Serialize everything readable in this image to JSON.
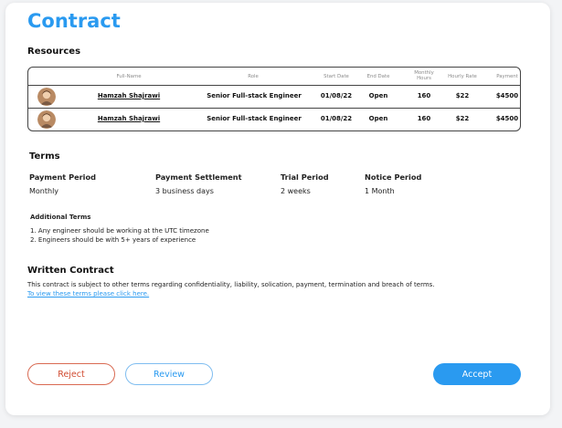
{
  "title": "Contract",
  "resources": {
    "title": "Resources",
    "headers": {
      "full_name": "Full-Name",
      "role": "Role",
      "start_date": "Start Date",
      "end_date": "End Date",
      "monthly_hours_1": "Monthly",
      "monthly_hours_2": "Hours",
      "hourly_rate": "Hourly Rate",
      "payment": "Payment"
    },
    "rows": [
      {
        "name": "Hamzah Shajrawi",
        "role": "Senior Full-stack Engineer",
        "start": "01/08/22",
        "end": "Open",
        "hours": "160",
        "rate": "$22",
        "payment": "$4500"
      },
      {
        "name": "Hamzah Shajrawi",
        "role": "Senior Full-stack Engineer",
        "start": "01/08/22",
        "end": "Open",
        "hours": "160",
        "rate": "$22",
        "payment": "$4500"
      }
    ]
  },
  "terms": {
    "title": "Terms",
    "payment_period": {
      "label": "Payment Period",
      "value": "Monthly"
    },
    "payment_settlement": {
      "label": "Payment Settlement",
      "value": "3 business days"
    },
    "trial_period": {
      "label": "Trial Period",
      "value": "2 weeks"
    },
    "notice_period": {
      "label": "Notice Period",
      "value": "1 Month"
    },
    "additional_title": "Additional Terms",
    "additional": [
      "1. Any engineer should be working at the UTC timezone",
      "2. Engineers should be with 5+ years of experience"
    ]
  },
  "written": {
    "title": "Written Contract",
    "text": "This contract is subject to other terms regarding confidentiality, liability, solication, payment, termination and breach of terms.",
    "link": "To view these terms please click here."
  },
  "buttons": {
    "reject": "Reject",
    "review": "Review",
    "accept": "Accept"
  },
  "colors": {
    "accent": "#2a9af0",
    "reject": "#d04a2f"
  }
}
